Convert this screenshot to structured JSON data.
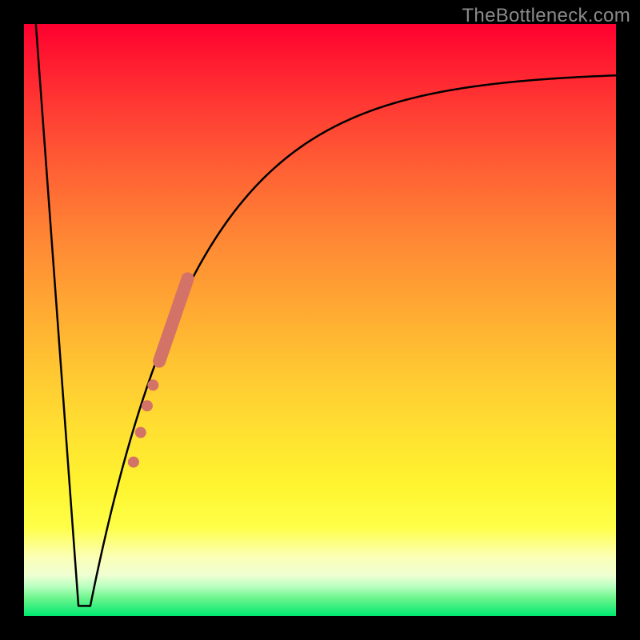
{
  "watermark": "TheBottleneck.com",
  "chart_data": {
    "type": "line",
    "title": "",
    "xlabel": "",
    "ylabel": "",
    "xlim": [
      0,
      100
    ],
    "ylim": [
      0,
      100
    ],
    "curve": {
      "description": "Bottleneck-style V-curve: a sharp linear drop from top-left to a narrow flat valley near the bottom, then a steep rise that decays toward the top-right.",
      "left_start": {
        "x": 2,
        "y": 100
      },
      "valley_left": {
        "x": 9.2,
        "y": 1.7
      },
      "valley_right": {
        "x": 11.2,
        "y": 1.7
      },
      "right_rise_anchor": {
        "x": 14,
        "y": 10
      },
      "asymptote_y": 92,
      "rise_rate": 0.055,
      "samples": 260
    },
    "scatter": {
      "color": "#d37266",
      "points": [
        {
          "x": 18.5,
          "y": 26,
          "r": 7
        },
        {
          "x": 19.7,
          "y": 31,
          "r": 7
        },
        {
          "x": 20.8,
          "y": 35.5,
          "r": 7
        },
        {
          "x": 21.8,
          "y": 39,
          "r": 7
        }
      ],
      "band": {
        "x_from": 22.5,
        "y_from": 42,
        "x_to": 28.0,
        "y_to": 58,
        "half_width": 8
      }
    },
    "background_gradient": {
      "orientation": "vertical",
      "stops": [
        {
          "pos": 0.0,
          "color": "#ff0030"
        },
        {
          "pos": 0.25,
          "color": "#ff6a34"
        },
        {
          "pos": 0.55,
          "color": "#ffc032"
        },
        {
          "pos": 0.8,
          "color": "#fff430"
        },
        {
          "pos": 0.92,
          "color": "#f6ffc8"
        },
        {
          "pos": 1.0,
          "color": "#00e970"
        }
      ]
    }
  }
}
